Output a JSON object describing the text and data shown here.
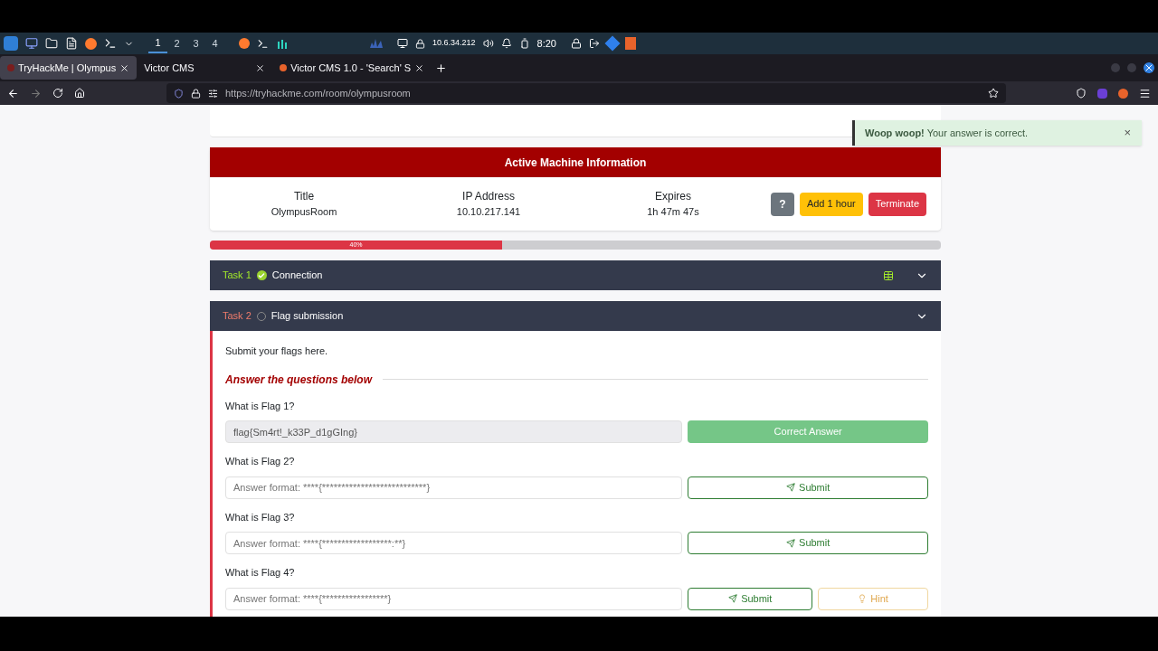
{
  "taskbar": {
    "workspaces": [
      {
        "label": "1",
        "selected": true
      },
      {
        "label": "2",
        "selected": false
      },
      {
        "label": "3",
        "selected": false
      },
      {
        "label": "4",
        "selected": false
      }
    ],
    "ip": "10.6.34.212",
    "time": "8:20"
  },
  "browser_tabs": [
    {
      "label": "TryHackMe | Olympus",
      "selected": true
    },
    {
      "label": "Victor CMS",
      "selected": false
    },
    {
      "label": "Victor CMS 1.0 - 'Search' S",
      "selected": false
    }
  ],
  "address_bar": {
    "url": "https://tryhackme.com/room/olympusroom"
  },
  "toast": {
    "title": "Woop woop!",
    "message": "Your answer is correct.",
    "close": "×"
  },
  "machine": {
    "header": "Active Machine Information",
    "fields": [
      {
        "label": "Title",
        "value": "OlympusRoom"
      },
      {
        "label": "IP Address",
        "value": "10.10.217.141"
      },
      {
        "label": "Expires",
        "value": "1h 47m 47s"
      }
    ],
    "help": "?",
    "add_button": "Add 1 hour",
    "terminate_button": "Terminate"
  },
  "progress": {
    "label": "40%",
    "level": 0.4
  },
  "tasks": [
    {
      "number": "Task 1",
      "title": "Connection",
      "done": true,
      "expanded": false
    },
    {
      "number": "Task 2",
      "title": "Flag submission",
      "done": false,
      "expanded": true
    }
  ],
  "task_body": {
    "intro": "Submit your flags here.",
    "heading": "Answer the questions below",
    "questions": [
      {
        "question": "What is Flag 1?",
        "value": "flag{Sm4rt!_k33P_d1gGIng}",
        "answered": true,
        "button": "Correct Answer"
      },
      {
        "question": "What is Flag 2?",
        "placeholder": "Answer format: ****{***************************}",
        "answered": false,
        "button": "Submit"
      },
      {
        "question": "What is Flag 3?",
        "placeholder": "Answer format: ****{******************:**}",
        "answered": false,
        "button": "Submit"
      },
      {
        "question": "What is Flag 4?",
        "placeholder": "Answer format: ****{*****************}",
        "answered": false,
        "button": "Submit",
        "hint": "Hint"
      }
    ]
  }
}
